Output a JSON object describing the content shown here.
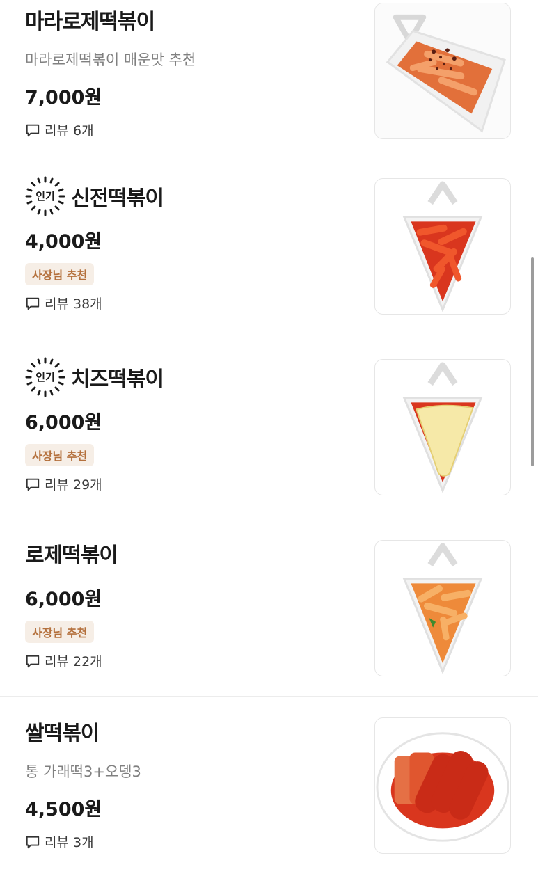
{
  "menu": {
    "items": [
      {
        "title": "마라로제떡볶이",
        "description": "마라로제떡볶이 매운맛 추천",
        "price": "7,000원",
        "review_icon": "speech-bubble-icon",
        "review": "리뷰 6개",
        "image": "mara-rose-tteokbokki-photo"
      },
      {
        "popular_label": "인기",
        "title": "신전떡볶이",
        "price": "4,000원",
        "badge": "사장님 추천",
        "review_icon": "speech-bubble-icon",
        "review": "리뷰 38개",
        "image": "sinjeon-tteokbokki-photo"
      },
      {
        "popular_label": "인기",
        "title": "치즈떡볶이",
        "price": "6,000원",
        "badge": "사장님 추천",
        "review_icon": "speech-bubble-icon",
        "review": "리뷰 29개",
        "image": "cheese-tteokbokki-photo"
      },
      {
        "title": "로제떡볶이",
        "price": "6,000원",
        "badge": "사장님 추천",
        "review_icon": "speech-bubble-icon",
        "review": "리뷰 22개",
        "image": "rose-tteokbokki-photo"
      },
      {
        "title": "쌀떡볶이",
        "description": "통 가래떡3+오뎅3",
        "price": "4,500원",
        "review_icon": "speech-bubble-icon",
        "review": "리뷰 3개",
        "image": "rice-tteokbokki-photo"
      }
    ]
  },
  "colors": {
    "badge_bg": "#f6eee6",
    "badge_text": "#b4703c",
    "sauce_red": "#d9361e",
    "rose_orange": "#ee8a3a"
  }
}
